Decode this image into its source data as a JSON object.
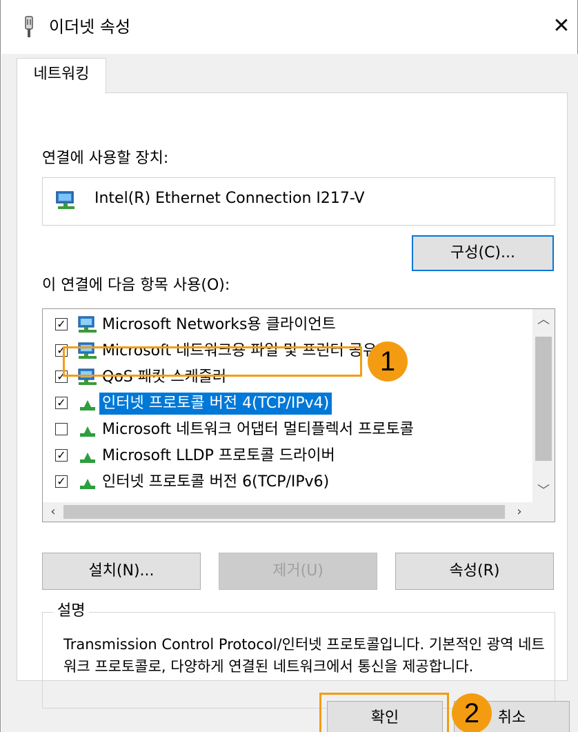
{
  "window": {
    "title": "이더넷 속성",
    "close_glyph": "✕"
  },
  "tabs": [
    {
      "label": "네트워킹"
    }
  ],
  "connect_using": {
    "label": "연결에 사용할 장치:",
    "device_name": "Intel(R) Ethernet Connection I217-V",
    "configure_button": "구성(C)..."
  },
  "items_section": {
    "label": "이 연결에 다음 항목 사용(O):",
    "items": [
      {
        "label": "Microsoft Networks용 클라이언트",
        "checked": true,
        "icon": "network-client-icon"
      },
      {
        "label": "Microsoft 네트워크용 파일 및 프린터 공유",
        "checked": true,
        "icon": "network-service-icon"
      },
      {
        "label": "QoS 패킷 스케줄러",
        "checked": true,
        "icon": "network-service-icon"
      },
      {
        "label": "인터넷 프로토콜 버전 4(TCP/IPv4)",
        "checked": true,
        "icon": "protocol-icon",
        "selected": true
      },
      {
        "label": "Microsoft 네트워크 어댑터 멀티플렉서 프로토콜",
        "checked": false,
        "icon": "protocol-icon"
      },
      {
        "label": "Microsoft LLDP 프로토콜 드라이버",
        "checked": true,
        "icon": "protocol-icon"
      },
      {
        "label": "인터넷 프로토콜 버전 6(TCP/IPv6)",
        "checked": true,
        "icon": "protocol-icon"
      }
    ]
  },
  "buttons": {
    "install": "설치(N)...",
    "uninstall": "제거(U)",
    "properties": "속성(R)",
    "ok": "확인",
    "cancel": "취소"
  },
  "description": {
    "legend": "설명",
    "text": "Transmission Control Protocol/인터넷 프로토콜입니다. 기본적인 광역 네트워크 프로토콜로, 다양하게 연결된 네트워크에서 통신을 제공합니다."
  },
  "annotations": {
    "step1": "1",
    "step2": "2",
    "highlight_color": "#f39c12"
  },
  "colors": {
    "selection": "#0078d7",
    "focus_border": "#0078d7"
  }
}
